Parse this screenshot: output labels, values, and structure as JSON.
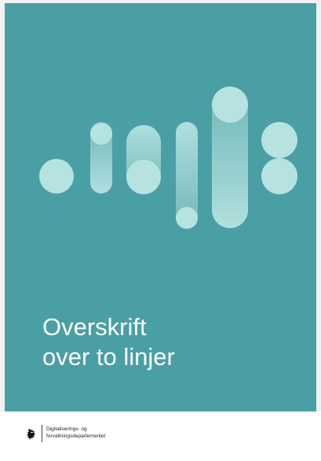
{
  "cover": {
    "background_color": "#4a9fa5",
    "shape_color": "#b6e3e0",
    "title_lines": [
      "Overskrift",
      "over to linjer"
    ]
  },
  "footer": {
    "logo_icon": "norwegian-lion-coat-of-arms-icon",
    "department_lines": [
      "Digitaliserings- og",
      "forvaltningsdepartementet"
    ]
  }
}
